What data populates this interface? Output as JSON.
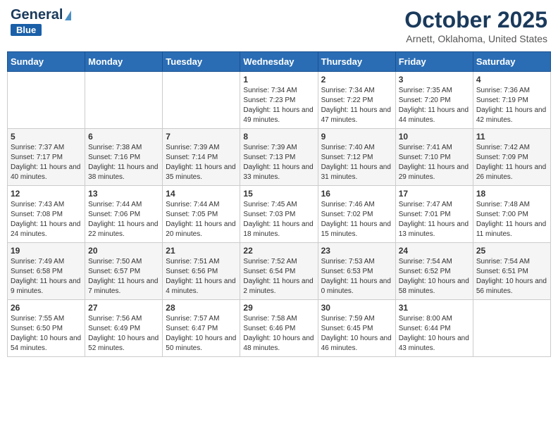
{
  "header": {
    "logo_general": "General",
    "logo_blue": "Blue",
    "title": "October 2025",
    "location": "Arnett, Oklahoma, United States"
  },
  "days_of_week": [
    "Sunday",
    "Monday",
    "Tuesday",
    "Wednesday",
    "Thursday",
    "Friday",
    "Saturday"
  ],
  "weeks": [
    [
      {
        "day": "",
        "content": ""
      },
      {
        "day": "",
        "content": ""
      },
      {
        "day": "",
        "content": ""
      },
      {
        "day": "1",
        "content": "Sunrise: 7:34 AM\nSunset: 7:23 PM\nDaylight: 11 hours and 49 minutes."
      },
      {
        "day": "2",
        "content": "Sunrise: 7:34 AM\nSunset: 7:22 PM\nDaylight: 11 hours and 47 minutes."
      },
      {
        "day": "3",
        "content": "Sunrise: 7:35 AM\nSunset: 7:20 PM\nDaylight: 11 hours and 44 minutes."
      },
      {
        "day": "4",
        "content": "Sunrise: 7:36 AM\nSunset: 7:19 PM\nDaylight: 11 hours and 42 minutes."
      }
    ],
    [
      {
        "day": "5",
        "content": "Sunrise: 7:37 AM\nSunset: 7:17 PM\nDaylight: 11 hours and 40 minutes."
      },
      {
        "day": "6",
        "content": "Sunrise: 7:38 AM\nSunset: 7:16 PM\nDaylight: 11 hours and 38 minutes."
      },
      {
        "day": "7",
        "content": "Sunrise: 7:39 AM\nSunset: 7:14 PM\nDaylight: 11 hours and 35 minutes."
      },
      {
        "day": "8",
        "content": "Sunrise: 7:39 AM\nSunset: 7:13 PM\nDaylight: 11 hours and 33 minutes."
      },
      {
        "day": "9",
        "content": "Sunrise: 7:40 AM\nSunset: 7:12 PM\nDaylight: 11 hours and 31 minutes."
      },
      {
        "day": "10",
        "content": "Sunrise: 7:41 AM\nSunset: 7:10 PM\nDaylight: 11 hours and 29 minutes."
      },
      {
        "day": "11",
        "content": "Sunrise: 7:42 AM\nSunset: 7:09 PM\nDaylight: 11 hours and 26 minutes."
      }
    ],
    [
      {
        "day": "12",
        "content": "Sunrise: 7:43 AM\nSunset: 7:08 PM\nDaylight: 11 hours and 24 minutes."
      },
      {
        "day": "13",
        "content": "Sunrise: 7:44 AM\nSunset: 7:06 PM\nDaylight: 11 hours and 22 minutes."
      },
      {
        "day": "14",
        "content": "Sunrise: 7:44 AM\nSunset: 7:05 PM\nDaylight: 11 hours and 20 minutes."
      },
      {
        "day": "15",
        "content": "Sunrise: 7:45 AM\nSunset: 7:03 PM\nDaylight: 11 hours and 18 minutes."
      },
      {
        "day": "16",
        "content": "Sunrise: 7:46 AM\nSunset: 7:02 PM\nDaylight: 11 hours and 15 minutes."
      },
      {
        "day": "17",
        "content": "Sunrise: 7:47 AM\nSunset: 7:01 PM\nDaylight: 11 hours and 13 minutes."
      },
      {
        "day": "18",
        "content": "Sunrise: 7:48 AM\nSunset: 7:00 PM\nDaylight: 11 hours and 11 minutes."
      }
    ],
    [
      {
        "day": "19",
        "content": "Sunrise: 7:49 AM\nSunset: 6:58 PM\nDaylight: 11 hours and 9 minutes."
      },
      {
        "day": "20",
        "content": "Sunrise: 7:50 AM\nSunset: 6:57 PM\nDaylight: 11 hours and 7 minutes."
      },
      {
        "day": "21",
        "content": "Sunrise: 7:51 AM\nSunset: 6:56 PM\nDaylight: 11 hours and 4 minutes."
      },
      {
        "day": "22",
        "content": "Sunrise: 7:52 AM\nSunset: 6:54 PM\nDaylight: 11 hours and 2 minutes."
      },
      {
        "day": "23",
        "content": "Sunrise: 7:53 AM\nSunset: 6:53 PM\nDaylight: 11 hours and 0 minutes."
      },
      {
        "day": "24",
        "content": "Sunrise: 7:54 AM\nSunset: 6:52 PM\nDaylight: 10 hours and 58 minutes."
      },
      {
        "day": "25",
        "content": "Sunrise: 7:54 AM\nSunset: 6:51 PM\nDaylight: 10 hours and 56 minutes."
      }
    ],
    [
      {
        "day": "26",
        "content": "Sunrise: 7:55 AM\nSunset: 6:50 PM\nDaylight: 10 hours and 54 minutes."
      },
      {
        "day": "27",
        "content": "Sunrise: 7:56 AM\nSunset: 6:49 PM\nDaylight: 10 hours and 52 minutes."
      },
      {
        "day": "28",
        "content": "Sunrise: 7:57 AM\nSunset: 6:47 PM\nDaylight: 10 hours and 50 minutes."
      },
      {
        "day": "29",
        "content": "Sunrise: 7:58 AM\nSunset: 6:46 PM\nDaylight: 10 hours and 48 minutes."
      },
      {
        "day": "30",
        "content": "Sunrise: 7:59 AM\nSunset: 6:45 PM\nDaylight: 10 hours and 46 minutes."
      },
      {
        "day": "31",
        "content": "Sunrise: 8:00 AM\nSunset: 6:44 PM\nDaylight: 10 hours and 43 minutes."
      },
      {
        "day": "",
        "content": ""
      }
    ]
  ]
}
